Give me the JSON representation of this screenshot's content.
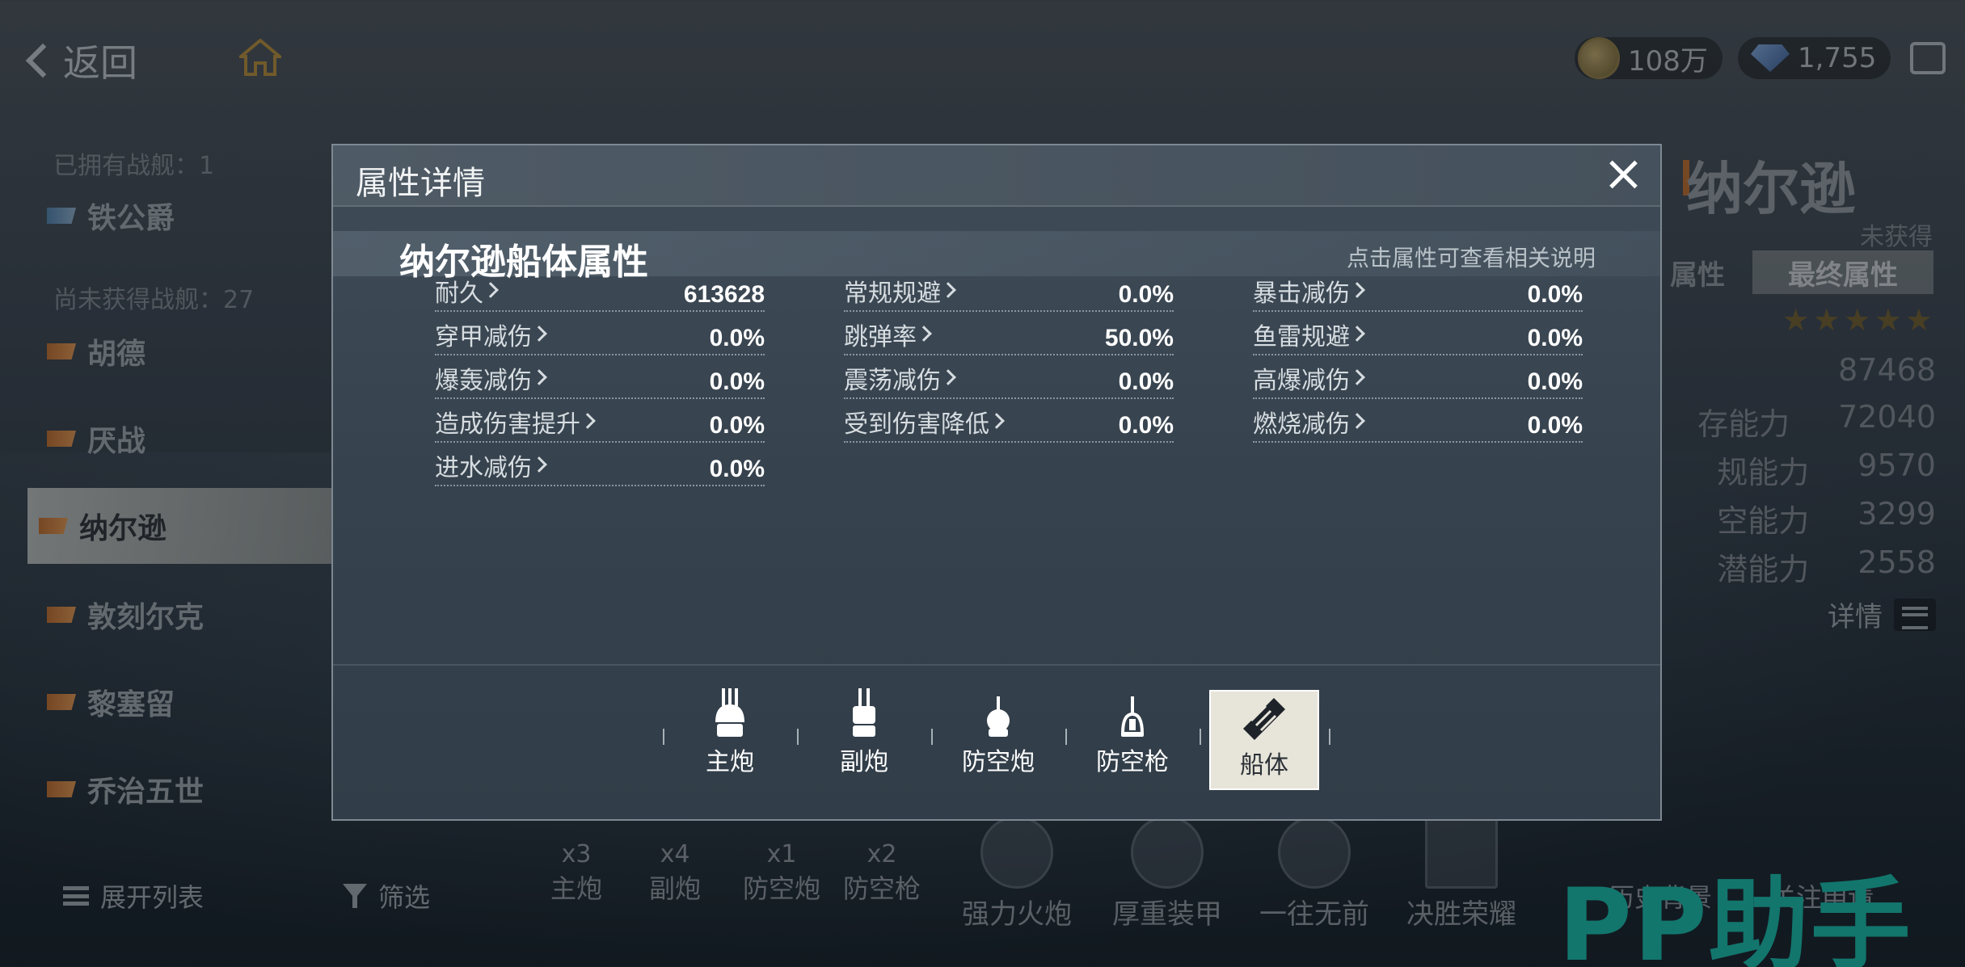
{
  "top_bar": {
    "back_label": "返回",
    "gold": "108万",
    "diamonds": "1,755"
  },
  "left_list": {
    "owned_label": "已拥有战舰：1",
    "unowned_label": "尚未获得战舰：27",
    "ships": [
      {
        "name": "铁公爵"
      },
      {
        "name": "胡德"
      },
      {
        "name": "厌战"
      },
      {
        "name": "纳尔逊"
      },
      {
        "name": "敦刻尔克"
      },
      {
        "name": "黎塞留"
      },
      {
        "name": "乔治五世"
      }
    ],
    "expand_label": "展开列表",
    "filter_label": "筛选"
  },
  "right_panel": {
    "ship_name": "纳尔逊",
    "status": "未获得",
    "tab_base": "属性",
    "tab_final": "最终属性",
    "stars": "★★★★★",
    "stats": [
      {
        "label": "",
        "value": "87468"
      },
      {
        "label": "存能力",
        "value": "72040"
      },
      {
        "label": "规能力",
        "value": "9570"
      },
      {
        "label": "空能力",
        "value": "3299"
      },
      {
        "label": "潜能力",
        "value": "2558"
      }
    ],
    "detail_label": "详情"
  },
  "bottom_bar": {
    "weapons": [
      {
        "label": "主炮",
        "count": "x3"
      },
      {
        "label": "副炮",
        "count": "x4"
      },
      {
        "label": "防空炮",
        "count": "x1"
      },
      {
        "label": "防空枪",
        "count": "x2"
      }
    ],
    "skills": [
      {
        "label": "强力火炮"
      },
      {
        "label": "厚重装甲"
      },
      {
        "label": "一往无前"
      },
      {
        "label": "决胜荣耀"
      }
    ],
    "history_label": "历史背景",
    "focus_label": "关注申请"
  },
  "watermark": "PP助手",
  "modal": {
    "title": "属性详情",
    "section_title": "纳尔逊船体属性",
    "hint": "点击属性可查看相关说明",
    "attributes": [
      {
        "name": "耐久",
        "value": "613628"
      },
      {
        "name": "常规规避",
        "value": "0.0%"
      },
      {
        "name": "暴击减伤",
        "value": "0.0%"
      },
      {
        "name": "穿甲减伤",
        "value": "0.0%"
      },
      {
        "name": "跳弹率",
        "value": "50.0%"
      },
      {
        "name": "鱼雷规避",
        "value": "0.0%"
      },
      {
        "name": "爆轰减伤",
        "value": "0.0%"
      },
      {
        "name": "震荡减伤",
        "value": "0.0%"
      },
      {
        "name": "高爆减伤",
        "value": "0.0%"
      },
      {
        "name": "造成伤害提升",
        "value": "0.0%"
      },
      {
        "name": "受到伤害降低",
        "value": "0.0%"
      },
      {
        "name": "燃烧减伤",
        "value": "0.0%"
      },
      {
        "name": "进水减伤",
        "value": "0.0%"
      }
    ],
    "tabs": [
      {
        "label": "主炮",
        "icon": "main-gun-icon"
      },
      {
        "label": "副炮",
        "icon": "secondary-gun-icon"
      },
      {
        "label": "防空炮",
        "icon": "aa-cannon-icon"
      },
      {
        "label": "防空枪",
        "icon": "aa-gun-icon"
      },
      {
        "label": "船体",
        "icon": "hull-icon",
        "active": true
      }
    ]
  }
}
